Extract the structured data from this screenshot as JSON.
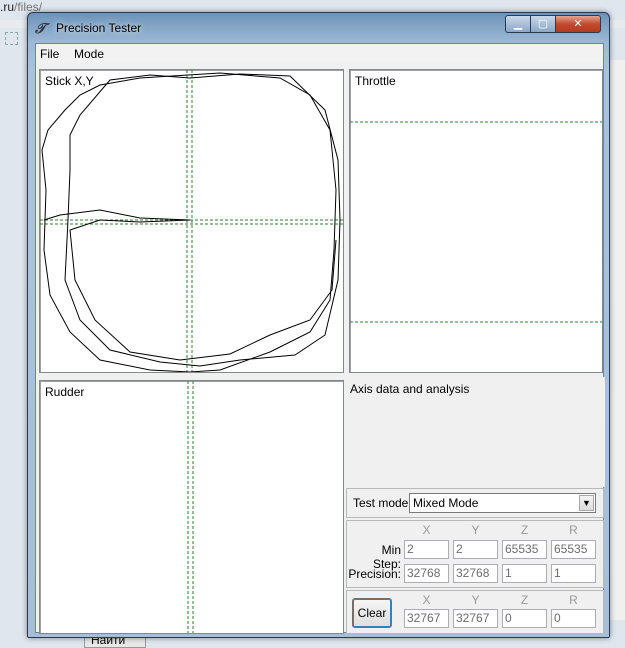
{
  "background": {
    "url_prefix": ".ru",
    "url_path": "/files/",
    "button_label": "Найти"
  },
  "window": {
    "title": "Precision Tester",
    "menu": [
      {
        "label": "File"
      },
      {
        "label": "Mode"
      }
    ]
  },
  "panels": {
    "stick": {
      "label": "Stick X,Y"
    },
    "throttle": {
      "label": "Throttle"
    },
    "rudder": {
      "label": "Rudder"
    },
    "analysis": {
      "label": "Axis data and analysis"
    }
  },
  "test_mode": {
    "label": "Test mode:",
    "selected": "Mixed Mode"
  },
  "stats": {
    "columns": [
      "X",
      "Y",
      "Z",
      "R"
    ],
    "min_step": {
      "label": "Min Step:",
      "values": [
        "2",
        "2",
        "65535",
        "65535"
      ]
    },
    "precision": {
      "label": "Precision:",
      "values": [
        "32768",
        "32768",
        "1",
        "1"
      ]
    }
  },
  "current": {
    "columns": [
      "X",
      "Y",
      "Z",
      "R"
    ],
    "clear_label": "Clear",
    "values": [
      "32767",
      "32767",
      "0",
      "0"
    ]
  },
  "colors": {
    "guide": "#2e7d32",
    "trace": "#000000"
  }
}
